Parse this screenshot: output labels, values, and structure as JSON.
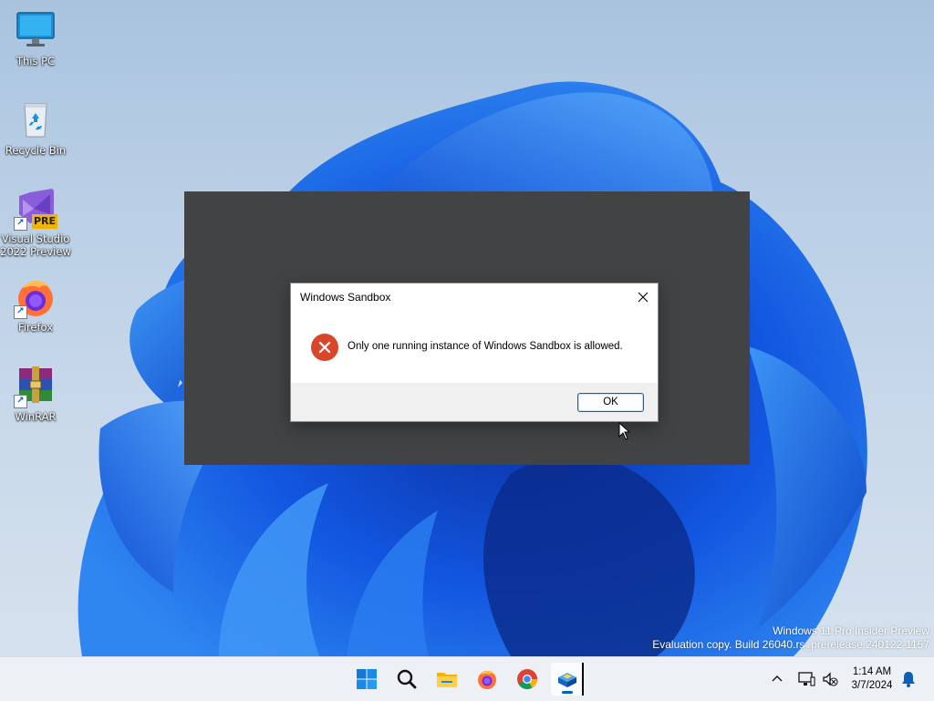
{
  "desktop": {
    "icons": [
      {
        "label": "This PC",
        "icon": "monitor-icon"
      },
      {
        "label": "Recycle Bin",
        "icon": "recycle-bin-icon"
      },
      {
        "label": "Visual Studio 2022 Preview",
        "icon": "visual-studio-icon",
        "badge": "PRE",
        "shortcut": true
      },
      {
        "label": "Firefox",
        "icon": "firefox-icon",
        "shortcut": true
      },
      {
        "label": "WinRAR",
        "icon": "winrar-icon",
        "shortcut": true
      }
    ],
    "watermark": {
      "line1": "Windows 11 Pro Insider Preview",
      "line2": "Evaluation copy. Build 26040.rs_prerelease.240122-1157"
    }
  },
  "dialog": {
    "title": "Windows Sandbox",
    "message": "Only one running instance of Windows Sandbox is allowed.",
    "ok_label": "OK",
    "icon": "error-icon"
  },
  "taskbar": {
    "apps": [
      {
        "name": "Start",
        "icon": "windows-start-icon"
      },
      {
        "name": "Search",
        "icon": "search-icon"
      },
      {
        "name": "File Explorer",
        "icon": "file-explorer-icon"
      },
      {
        "name": "Firefox",
        "icon": "firefox-icon"
      },
      {
        "name": "Chrome",
        "icon": "chrome-icon"
      },
      {
        "name": "Windows Sandbox",
        "icon": "sandbox-icon",
        "active": true
      }
    ],
    "clock": {
      "time": "1:14 AM",
      "date": "3/7/2024"
    }
  },
  "colors": {
    "accent": "#0067c0",
    "error": "#d9472b",
    "sandbox_window_bg": "#414345",
    "taskbar_bg": "#edf1f6"
  }
}
